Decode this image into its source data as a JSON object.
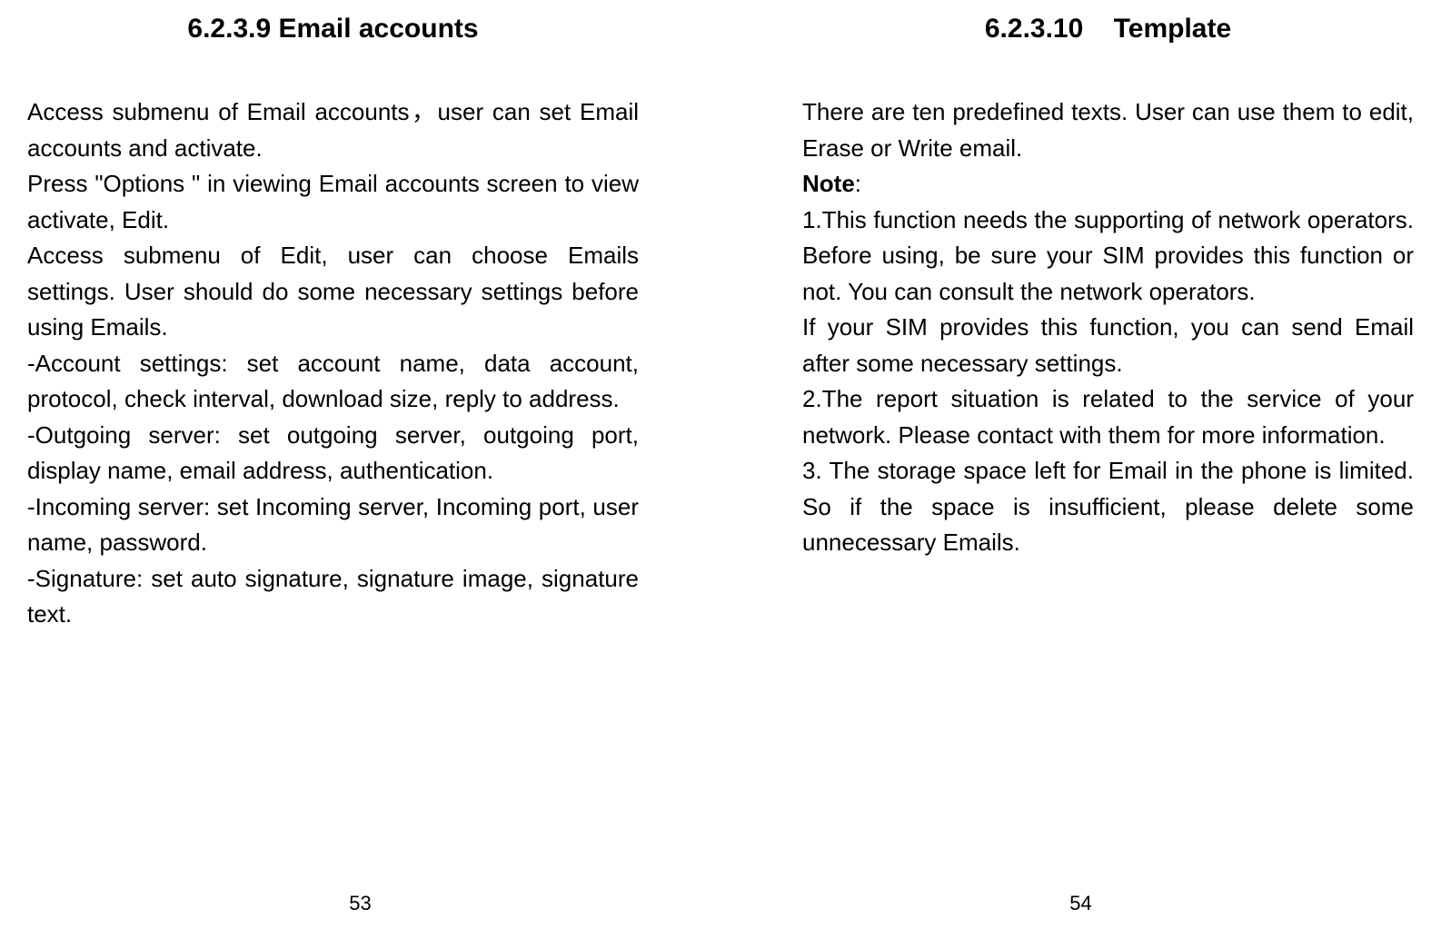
{
  "left": {
    "heading_num": "6.2.3.9",
    "heading_text": "Email accounts",
    "p1": "Access submenu of Email accounts，user can set Email accounts and activate.",
    "p2": "Press \"Options \" in viewing Email accounts screen to view activate, Edit.",
    "p3": "Access submenu of Edit, user can choose Emails settings. User should do some necessary settings before using Emails.",
    "p4": "-Account settings: set account name, data account, protocol, check interval, download size, reply to address.",
    "p5": "-Outgoing server: set outgoing server, outgoing port, display name, email address, authentication.",
    "p6": "-Incoming server: set Incoming server, Incoming port, user name, password.",
    "p7": "-Signature: set auto signature, signature image, signature text.",
    "page_num": "53"
  },
  "right": {
    "heading_num": "6.2.3.10",
    "heading_text": "Template",
    "p1": "There are ten predefined texts. User can use them to edit, Erase or Write email.",
    "note_label": "Note",
    "note_colon": ":",
    "p2": "1.This function needs the supporting of network operators. Before using, be sure your SIM provides this function or not. You can consult the network operators.",
    "p3": "If your SIM provides this function, you can send Email after some necessary settings.",
    "p4": "2.The report situation is related to the service of your network. Please contact with them for more information.",
    "p5": "3. The storage space left for Email in the phone is limited. So if the space is insufficient, please delete some unnecessary Emails.",
    "page_num": "54"
  }
}
